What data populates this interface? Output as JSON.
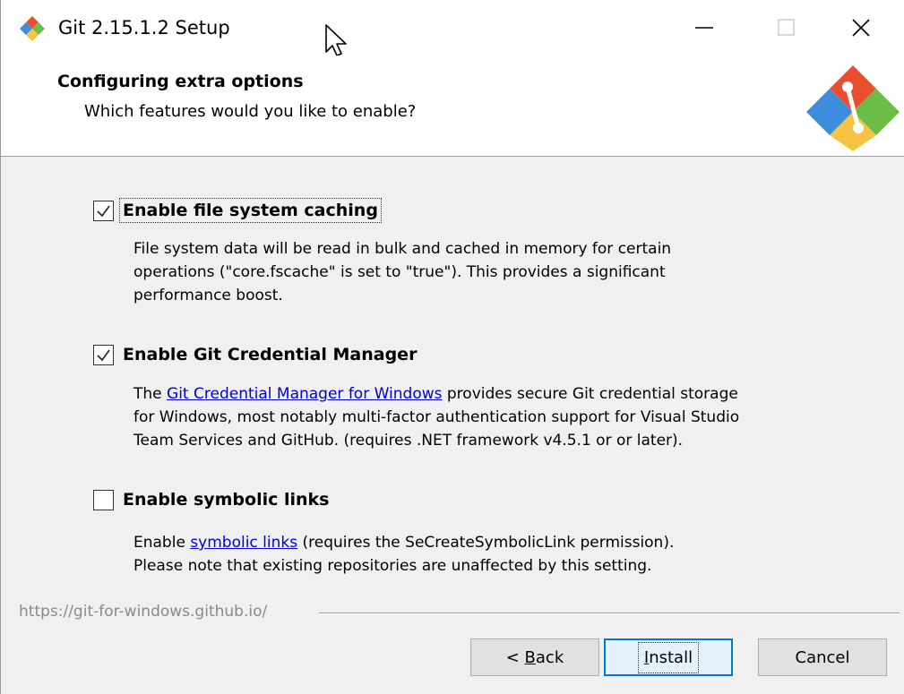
{
  "window": {
    "title": "Git 2.15.1.2 Setup",
    "controls": {
      "minimize_icon": "minimize-icon",
      "maximize_icon": "maximize-icon",
      "close_icon": "close-icon"
    }
  },
  "header": {
    "title": "Configuring extra options",
    "subtitle": "Which features would you like to enable?",
    "logo": "git-logo"
  },
  "options": [
    {
      "label": "Enable file system caching",
      "checked": true,
      "description_lines": [
        "File system data will be read in bulk and cached in memory for certain",
        "operations (\"core.fscache\" is set to \"true\"). This provides a significant",
        "performance boost."
      ]
    },
    {
      "label": "Enable Git Credential Manager",
      "checked": true,
      "desc_prefix": "The ",
      "desc_link": "Git Credential Manager for Windows",
      "desc_suffix": " provides secure Git credential storage",
      "description_lines": [
        "for Windows, most notably multi-factor authentication support for Visual Studio",
        "Team Services and GitHub. (requires .NET framework v4.5.1 or or later)."
      ]
    },
    {
      "label": "Enable symbolic links",
      "checked": false,
      "desc_prefix": "Enable ",
      "desc_link": "symbolic links",
      "desc_suffix": " (requires the SeCreateSymbolicLink permission).",
      "description_lines": [
        "Please note that existing repositories are unaffected by this setting."
      ]
    }
  ],
  "footer": {
    "url": "https://git-for-windows.github.io/",
    "buttons": {
      "back_prefix": "< ",
      "back_key": "B",
      "back_rest": "ack",
      "install_key": "I",
      "install_rest": "nstall",
      "cancel": "Cancel"
    }
  },
  "colors": {
    "link": "#0000e0",
    "accent": "#0078d7",
    "window_bg": "#f0f0f0",
    "header_bg": "#ffffff"
  }
}
